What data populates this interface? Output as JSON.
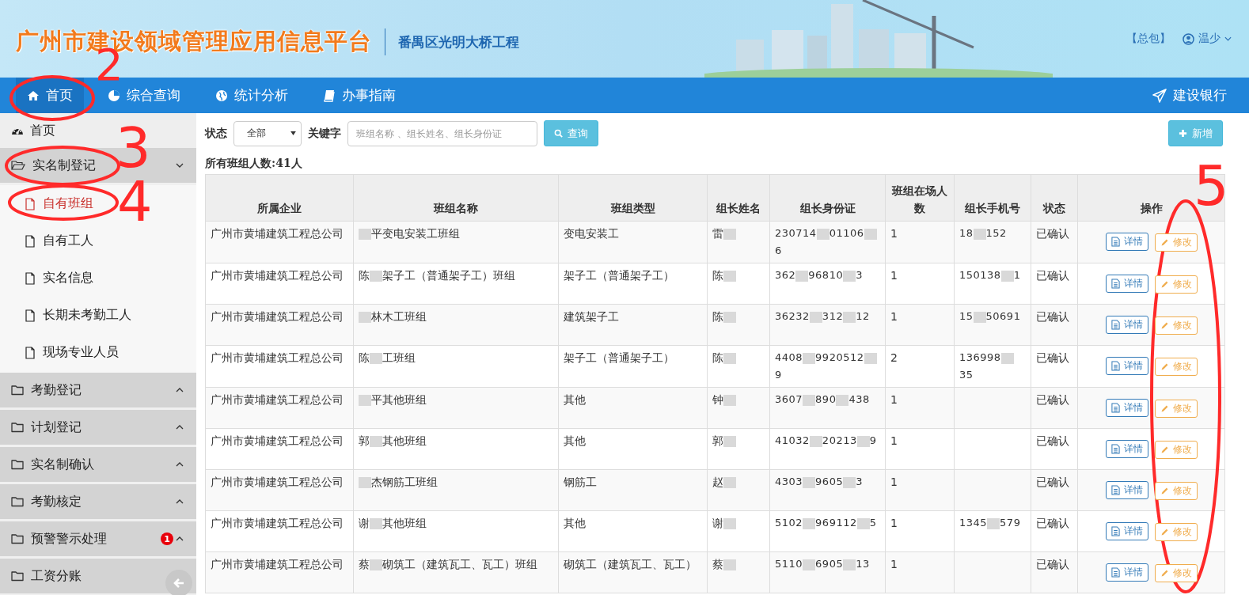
{
  "banner": {
    "title": "广州市建设领域管理应用信息平台",
    "project": "番禺区光明大桥工程",
    "role": "【总包】",
    "user": "温少"
  },
  "nav": {
    "items": [
      {
        "label": "首页",
        "selected": true
      },
      {
        "label": "综合查询",
        "selected": false
      },
      {
        "label": "统计分析",
        "selected": false
      },
      {
        "label": "办事指南",
        "selected": false
      }
    ],
    "right": "建设银行"
  },
  "sidebar": {
    "home": "首页",
    "groups": [
      {
        "label": "实名制登记",
        "expanded": true,
        "children": [
          {
            "label": "自有班组",
            "selected": true
          },
          {
            "label": "自有工人",
            "selected": false
          },
          {
            "label": "实名信息",
            "selected": false
          },
          {
            "label": "长期未考勤工人",
            "selected": false
          },
          {
            "label": "现场专业人员",
            "selected": false
          }
        ]
      },
      {
        "label": "考勤登记",
        "expanded": false
      },
      {
        "label": "计划登记",
        "expanded": false
      },
      {
        "label": "实名制确认",
        "expanded": false
      },
      {
        "label": "考勤核定",
        "expanded": false
      },
      {
        "label": "预警警示处理",
        "expanded": false,
        "badge": "1"
      },
      {
        "label": "工资分账",
        "expanded": false
      }
    ]
  },
  "filters": {
    "status_label": "状态",
    "status_value": "全部",
    "keyword_label": "关键字",
    "keyword_placeholder": "班组名称 、组长姓名、组长身份证",
    "search_button": "查询",
    "add_button": "新增"
  },
  "summary": "所有班组人数:41人",
  "table": {
    "columns": [
      "所属企业",
      "班组名称",
      "班组类型",
      "组长姓名",
      "组长身份证",
      "班组在场人数",
      "组长手机号",
      "状态",
      "操作"
    ],
    "rows": [
      {
        "company": "广州市黄埔建筑工程总公司",
        "team": [
          {
            "kind": "redacted"
          },
          {
            "kind": "text",
            "text": "平变电安装工班组"
          }
        ],
        "type": "变电安装工",
        "leader": [
          {
            "kind": "text",
            "text": "雷"
          },
          {
            "kind": "redacted"
          }
        ],
        "id": [
          {
            "kind": "text",
            "text": "230714"
          },
          {
            "kind": "redacted"
          },
          {
            "kind": "text",
            "text": "01106"
          },
          {
            "kind": "redacted"
          },
          {
            "kind": "text",
            "text": "6"
          }
        ],
        "count": "1",
        "phone": [
          {
            "kind": "text",
            "text": "18"
          },
          {
            "kind": "redacted"
          },
          {
            "kind": "text",
            "text": "152"
          }
        ],
        "status": "已确认",
        "actions": [
          "详情",
          "修改"
        ]
      },
      {
        "company": "广州市黄埔建筑工程总公司",
        "team": [
          {
            "kind": "text",
            "text": "陈"
          },
          {
            "kind": "redacted"
          },
          {
            "kind": "text",
            "text": "架子工（普通架子工）班组"
          }
        ],
        "type": "架子工（普通架子工）",
        "leader": [
          {
            "kind": "text",
            "text": "陈"
          },
          {
            "kind": "redacted"
          }
        ],
        "id": [
          {
            "kind": "text",
            "text": "362"
          },
          {
            "kind": "redacted"
          },
          {
            "kind": "text",
            "text": "96810"
          },
          {
            "kind": "redacted"
          },
          {
            "kind": "text",
            "text": "3"
          }
        ],
        "count": "1",
        "phone": [
          {
            "kind": "text",
            "text": "150138"
          },
          {
            "kind": "redacted"
          },
          {
            "kind": "text",
            "text": "1"
          }
        ],
        "status": "已确认",
        "actions": [
          "详情",
          "修改"
        ]
      },
      {
        "company": "广州市黄埔建筑工程总公司",
        "team": [
          {
            "kind": "redacted"
          },
          {
            "kind": "text",
            "text": "林木工班组"
          }
        ],
        "type": "建筑架子工",
        "leader": [
          {
            "kind": "text",
            "text": "陈"
          },
          {
            "kind": "redacted"
          }
        ],
        "id": [
          {
            "kind": "text",
            "text": "36232"
          },
          {
            "kind": "redacted"
          },
          {
            "kind": "text",
            "text": "312"
          },
          {
            "kind": "redacted"
          },
          {
            "kind": "text",
            "text": "12"
          }
        ],
        "count": "1",
        "phone": [
          {
            "kind": "text",
            "text": "15"
          },
          {
            "kind": "redacted"
          },
          {
            "kind": "text",
            "text": "50691"
          }
        ],
        "status": "已确认",
        "actions": [
          "详情",
          "修改"
        ]
      },
      {
        "company": "广州市黄埔建筑工程总公司",
        "team": [
          {
            "kind": "text",
            "text": "陈"
          },
          {
            "kind": "redacted"
          },
          {
            "kind": "text",
            "text": "工班组"
          }
        ],
        "type": "架子工（普通架子工）",
        "leader": [
          {
            "kind": "text",
            "text": "陈"
          },
          {
            "kind": "redacted"
          }
        ],
        "id": [
          {
            "kind": "text",
            "text": "4408"
          },
          {
            "kind": "redacted"
          },
          {
            "kind": "text",
            "text": "9920512"
          },
          {
            "kind": "redacted"
          },
          {
            "kind": "text",
            "text": "9"
          }
        ],
        "count": "2",
        "phone": [
          {
            "kind": "text",
            "text": "136998"
          },
          {
            "kind": "redacted"
          },
          {
            "kind": "text",
            "text": "35"
          }
        ],
        "status": "已确认",
        "actions": [
          "详情",
          "修改"
        ]
      },
      {
        "company": "广州市黄埔建筑工程总公司",
        "team": [
          {
            "kind": "redacted"
          },
          {
            "kind": "text",
            "text": "平其他班组"
          }
        ],
        "type": "其他",
        "leader": [
          {
            "kind": "text",
            "text": "钟"
          },
          {
            "kind": "redacted"
          }
        ],
        "id": [
          {
            "kind": "text",
            "text": "3607"
          },
          {
            "kind": "redacted"
          },
          {
            "kind": "text",
            "text": "890"
          },
          {
            "kind": "redacted"
          },
          {
            "kind": "text",
            "text": "438"
          }
        ],
        "count": "1",
        "status": "已确认",
        "actions": [
          "详情",
          "修改"
        ]
      },
      {
        "company": "广州市黄埔建筑工程总公司",
        "team": [
          {
            "kind": "text",
            "text": "郭"
          },
          {
            "kind": "redacted"
          },
          {
            "kind": "text",
            "text": "其他班组"
          }
        ],
        "type": "其他",
        "leader": [
          {
            "kind": "text",
            "text": "郭"
          },
          {
            "kind": "redacted"
          }
        ],
        "id": [
          {
            "kind": "text",
            "text": "41032"
          },
          {
            "kind": "redacted"
          },
          {
            "kind": "text",
            "text": "20213"
          },
          {
            "kind": "redacted"
          },
          {
            "kind": "text",
            "text": "9"
          }
        ],
        "count": "1",
        "status": "已确认",
        "actions": [
          "详情",
          "修改"
        ]
      },
      {
        "company": "广州市黄埔建筑工程总公司",
        "team": [
          {
            "kind": "redacted"
          },
          {
            "kind": "text",
            "text": "杰钢筋工班组"
          }
        ],
        "type": "钢筋工",
        "leader": [
          {
            "kind": "text",
            "text": "赵"
          },
          {
            "kind": "redacted"
          }
        ],
        "id": [
          {
            "kind": "text",
            "text": "4303"
          },
          {
            "kind": "redacted"
          },
          {
            "kind": "text",
            "text": "9605"
          },
          {
            "kind": "redacted"
          },
          {
            "kind": "text",
            "text": "3"
          }
        ],
        "count": "1",
        "status": "已确认",
        "actions": [
          "详情",
          "修改"
        ]
      },
      {
        "company": "广州市黄埔建筑工程总公司",
        "team": [
          {
            "kind": "text",
            "text": "谢"
          },
          {
            "kind": "redacted"
          },
          {
            "kind": "text",
            "text": "其他班组"
          }
        ],
        "type": "其他",
        "leader": [
          {
            "kind": "text",
            "text": "谢"
          },
          {
            "kind": "redacted"
          }
        ],
        "id": [
          {
            "kind": "text",
            "text": "5102"
          },
          {
            "kind": "redacted"
          },
          {
            "kind": "text",
            "text": "969112"
          },
          {
            "kind": "redacted"
          },
          {
            "kind": "text",
            "text": "5"
          }
        ],
        "count": "1",
        "phone": [
          {
            "kind": "text",
            "text": "1345"
          },
          {
            "kind": "redacted"
          },
          {
            "kind": "text",
            "text": "579"
          }
        ],
        "status": "已确认",
        "actions": [
          "详情",
          "修改"
        ]
      },
      {
        "company": "广州市黄埔建筑工程总公司",
        "team": [
          {
            "kind": "text",
            "text": "蔡"
          },
          {
            "kind": "redacted"
          },
          {
            "kind": "text",
            "text": "砌筑工（建筑瓦工、瓦工）班组"
          }
        ],
        "type": "砌筑工（建筑瓦工、瓦工）",
        "leader": [
          {
            "kind": "text",
            "text": "蔡"
          },
          {
            "kind": "redacted"
          }
        ],
        "id": [
          {
            "kind": "text",
            "text": "5110"
          },
          {
            "kind": "redacted"
          },
          {
            "kind": "text",
            "text": "6905"
          },
          {
            "kind": "redacted"
          },
          {
            "kind": "text",
            "text": "13"
          }
        ],
        "count": "1",
        "status": "已确认",
        "actions": [
          "详情",
          "修改"
        ]
      }
    ]
  },
  "annotations": [
    {
      "label": "2"
    },
    {
      "label": "3"
    },
    {
      "label": "4"
    },
    {
      "label": "5"
    }
  ]
}
